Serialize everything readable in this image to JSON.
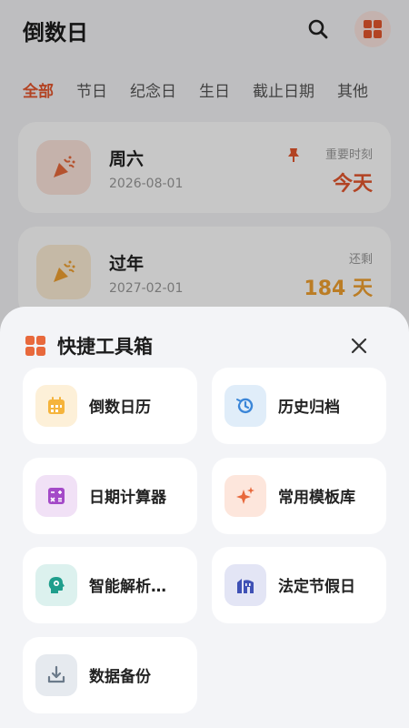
{
  "app": {
    "title": "倒数日"
  },
  "tabs": [
    "全部",
    "节日",
    "纪念日",
    "生日",
    "截止日期",
    "其他"
  ],
  "cards": [
    {
      "title": "周六",
      "date": "2026-08-01",
      "label": "重要时刻",
      "value": "今天",
      "pinned": true
    },
    {
      "title": "过年",
      "date": "2027-02-01",
      "label": "还剩",
      "value": "184 天",
      "pinned": false
    }
  ],
  "sheet": {
    "title": "快捷工具箱",
    "tools": [
      {
        "label": "倒数日历",
        "icon": "calendar-icon",
        "color": "#f5b43c",
        "bg": "#fdf0d8"
      },
      {
        "label": "历史归档",
        "icon": "history-icon",
        "color": "#3b86d8",
        "bg": "#e0edf9"
      },
      {
        "label": "日期计算器",
        "icon": "calculator-icon",
        "color": "#a44ac8",
        "bg": "#f1e1f6"
      },
      {
        "label": "常用模板库",
        "icon": "sparkle-icon",
        "color": "#e8693c",
        "bg": "#fde6dc"
      },
      {
        "label": "智能解析…",
        "icon": "ai-head-icon",
        "color": "#1f9e8c",
        "bg": "#dcf1ee"
      },
      {
        "label": "法定节假日",
        "icon": "building-icon",
        "color": "#3f51b5",
        "bg": "#e3e5f5"
      },
      {
        "label": "数据备份",
        "icon": "download-icon",
        "color": "#6b7a8a",
        "bg": "#e6eaef"
      }
    ]
  },
  "colors": {
    "accent": "#e4572e",
    "orange": "#f0a030"
  }
}
